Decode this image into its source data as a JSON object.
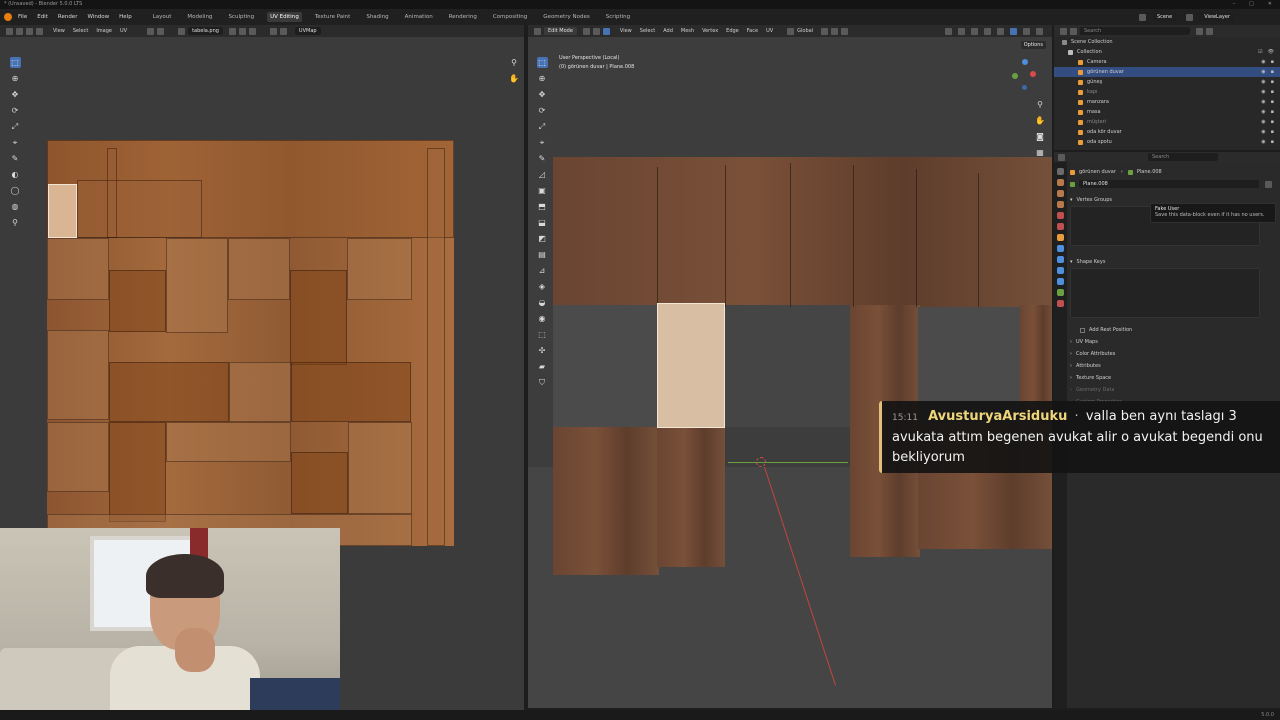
{
  "window": {
    "title": "* (Unsaved) - Blender 5.0.0 LTS",
    "controls": [
      "–",
      "□",
      "✕"
    ]
  },
  "menu": [
    "File",
    "Edit",
    "Render",
    "Window",
    "Help"
  ],
  "workspaces": [
    "Layout",
    "Modeling",
    "Sculpting",
    "UV Editing",
    "Texture Paint",
    "Shading",
    "Animation",
    "Rendering",
    "Compositing",
    "Geometry Nodes",
    "Scripting"
  ],
  "active_workspace": "UV Editing",
  "topbar_right": {
    "scene": "Scene",
    "view_layer": "ViewLayer"
  },
  "uv_editor": {
    "menus": [
      "View",
      "Select",
      "Image",
      "UV"
    ],
    "image_name": "tabela.png",
    "uv_map": "UVMap"
  },
  "viewport": {
    "mode": "Edit Mode",
    "menus": [
      "View",
      "Select",
      "Add",
      "Mesh",
      "Vertex",
      "Edge",
      "Face",
      "UV"
    ],
    "orientation": "Global",
    "options_label": "Options",
    "info_line1": "User Perspective (Local)",
    "info_line2": "(0) görünen duvar | Plane.008"
  },
  "outliner": {
    "search_placeholder": "Search",
    "root": "Scene Collection",
    "collection": "Collection",
    "items": [
      "Camera",
      "görünen duvar",
      "güneş",
      "kapı",
      "manzara",
      "masa",
      "müşteri",
      "oda kör duvar",
      "oda spotu"
    ],
    "selected_index": 1
  },
  "properties": {
    "search_placeholder": "Search",
    "breadcrumb_object": "görünen duvar",
    "breadcrumb_mesh": "Plane.008",
    "datablock": "Plane.008",
    "vertex_groups": "Vertex Groups",
    "shape_keys": "Shape Keys",
    "add_rest_position": "Add Rest Position",
    "sections": [
      "UV Maps",
      "Color Attributes",
      "Attributes",
      "Texture Space",
      "Geometry Data",
      "Custom Properties"
    ]
  },
  "tooltip": {
    "title": "Fake User",
    "text": "Save this data-block even if it has no users."
  },
  "chat": {
    "time": "15:11",
    "user": "AvusturyaArsiduku",
    "separator": "·",
    "message": "valla ben aynı taslagı 3 avukata attım begenen avukat alir o avukat begendi onu bekliyorum"
  },
  "status": {
    "version": "5.0.0"
  },
  "colors": {
    "accent": "#4772b3",
    "selection": "#334d80",
    "wood": "#8c5530",
    "chat_user": "#f0d67a"
  }
}
